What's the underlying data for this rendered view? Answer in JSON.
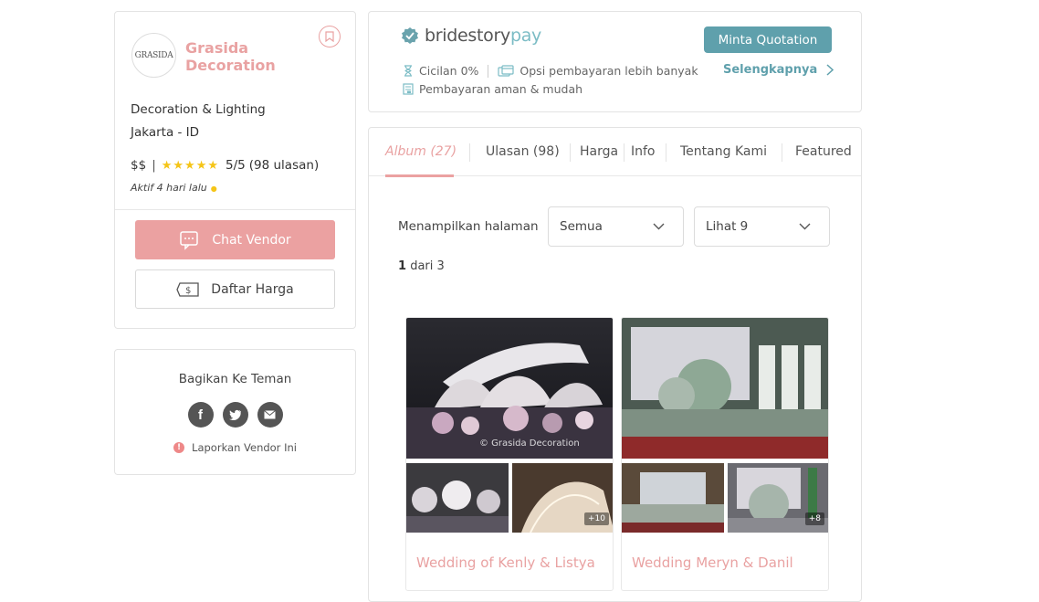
{
  "vendor": {
    "logo_text": "GRASIDA",
    "name": "Grasida Decoration",
    "category": "Decoration & Lighting",
    "location": "Jakarta -  ID",
    "price_level": "$$",
    "stars": "★★★★★",
    "rating": "5/5",
    "reviews": "(98 ulasan)",
    "active_status": "Aktif 4 hari lalu",
    "chat_label": "Chat Vendor",
    "price_list_label": "Daftar Harga"
  },
  "share": {
    "title": "Bagikan Ke Teman",
    "report_label": "Laporkan Vendor Ini"
  },
  "pay": {
    "brand": "bridestory",
    "brand_suffix": "pay",
    "installment": "Cicilan 0%",
    "more_options": "Opsi pembayaran lebih banyak",
    "secure": "Pembayaran aman & mudah",
    "quote_button": "Minta Quotation",
    "more_link": "Selengkapnya"
  },
  "tabs": [
    {
      "label": "Album (27)"
    },
    {
      "label": "Ulasan (98)"
    },
    {
      "label": "Harga"
    },
    {
      "label": "Info"
    },
    {
      "label": "Tentang Kami"
    },
    {
      "label": "Featured"
    }
  ],
  "filters": {
    "showing_label": "Menampilkan halaman",
    "category_value": "Semua",
    "per_page_value": "Lihat 9"
  },
  "pagination": {
    "current": "1",
    "of_label": "dari 3"
  },
  "albums": [
    {
      "title": "Wedding of Kenly & Listya",
      "watermark": "© Grasida Decoration",
      "more_count": "+10"
    },
    {
      "title": "Wedding Meryn & Danil",
      "more_count": "+8"
    }
  ],
  "colors": {
    "brand_pink": "#e9a2a2",
    "chat_button": "#eba1a1",
    "teal": "#5fa0ac",
    "star": "#f5c518"
  }
}
